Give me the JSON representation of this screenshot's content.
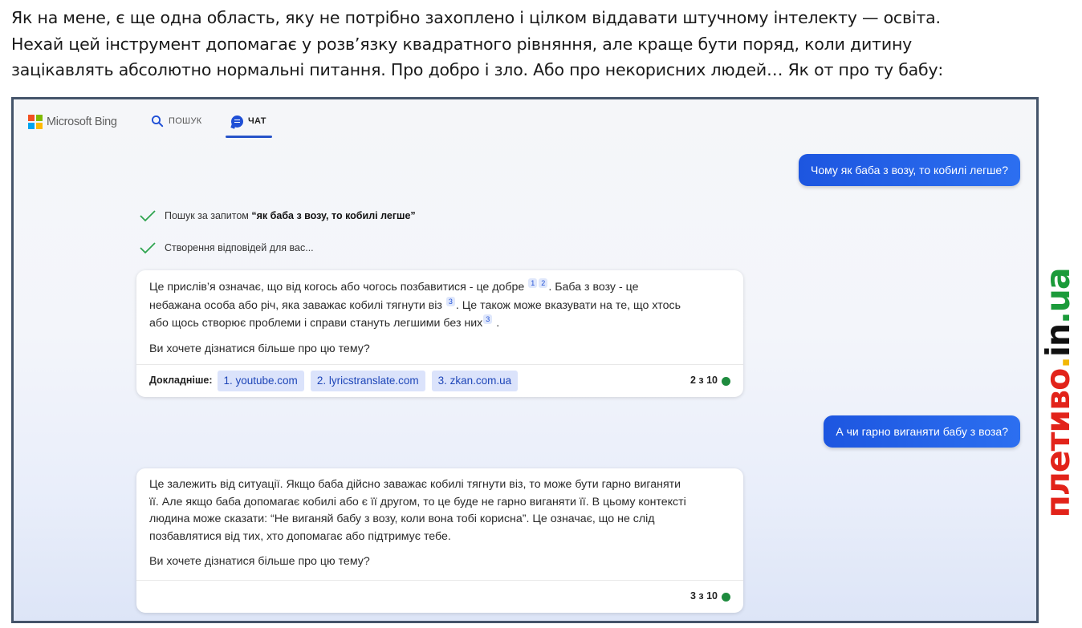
{
  "intro": {
    "line1": "Як на мене, є ще одна область, яку не потрібно захоплено і цілком віддавати штучному інтелекту  — освіта.",
    "line2": "Нехай цей інструмент допомагає у розв’язку квадратного рівняння, але краще бути поряд, коли дитину",
    "line3": "зацікавлять абсолютно нормальні питання. Про добро і зло. Або про некорисних людей…  Як от про ту бабу:"
  },
  "header": {
    "logo_text": "Microsoft Bing",
    "search_tab": "ПОШУК",
    "chat_tab": "ЧАТ",
    "logo_colors": [
      "#f25022",
      "#7fba00",
      "#00a4ef",
      "#ffb900"
    ],
    "accent": "#1f4fd6"
  },
  "conversation": {
    "q1": "Чому як баба з возу, то кобилі легше?",
    "status1_prefix": "Пошук за запитом ",
    "status1_query": "“як баба з возу, то кобилі легше”",
    "status2": "Створення відповідей для вас...",
    "a1": {
      "p1_a": "Це прислів’я означає, що від когось або чогось позбавитися - це добре",
      "ref1": "1",
      "ref2": "2",
      "p1_b": ". Баба з возу - це",
      "p1_c": "небажана особа або річ, яка заважає кобилі тягнути віз",
      "ref3": "3",
      "p1_d": ". Це також може вказувати на те, що хтось",
      "p1_e": "або щось створює проблеми і справи стануть легшими без них",
      "ref4": "3",
      "p1_f": ".",
      "p2": "Ви хочете дізнатися більше про цю тему?",
      "more_label": "Докладніше:",
      "sources": [
        "1. youtube.com",
        "2. lyricstranslate.com",
        "3. zkan.com.ua"
      ],
      "counter": "2 з 10"
    },
    "q2": "А чи гарно виганяти бабу з воза?",
    "a2": {
      "line1": "Це залежить від ситуації. Якщо баба дійсно заважає кобилі тягнути віз, то може бути гарно виганяти",
      "line2": "її. Але якщо баба допомагає кобилі або є її другом, то це буде не гарно виганяти її. В цьому контексті",
      "line3": "людина може сказати: “Не виганяй бабу з возу, коли вона тобі корисна”. Це означає, що не слід",
      "line4": "позбавлятися від тих, хто допомагає або підтримує тебе.",
      "p2": "Ви хочете дізнатися більше про цю тему?",
      "counter": "3 з 10"
    },
    "counter_dot_color": "#1e8b3e"
  },
  "watermark": {
    "part1": "плетиво",
    "part2": ".",
    "part3": "in",
    "part4": ".ua"
  }
}
